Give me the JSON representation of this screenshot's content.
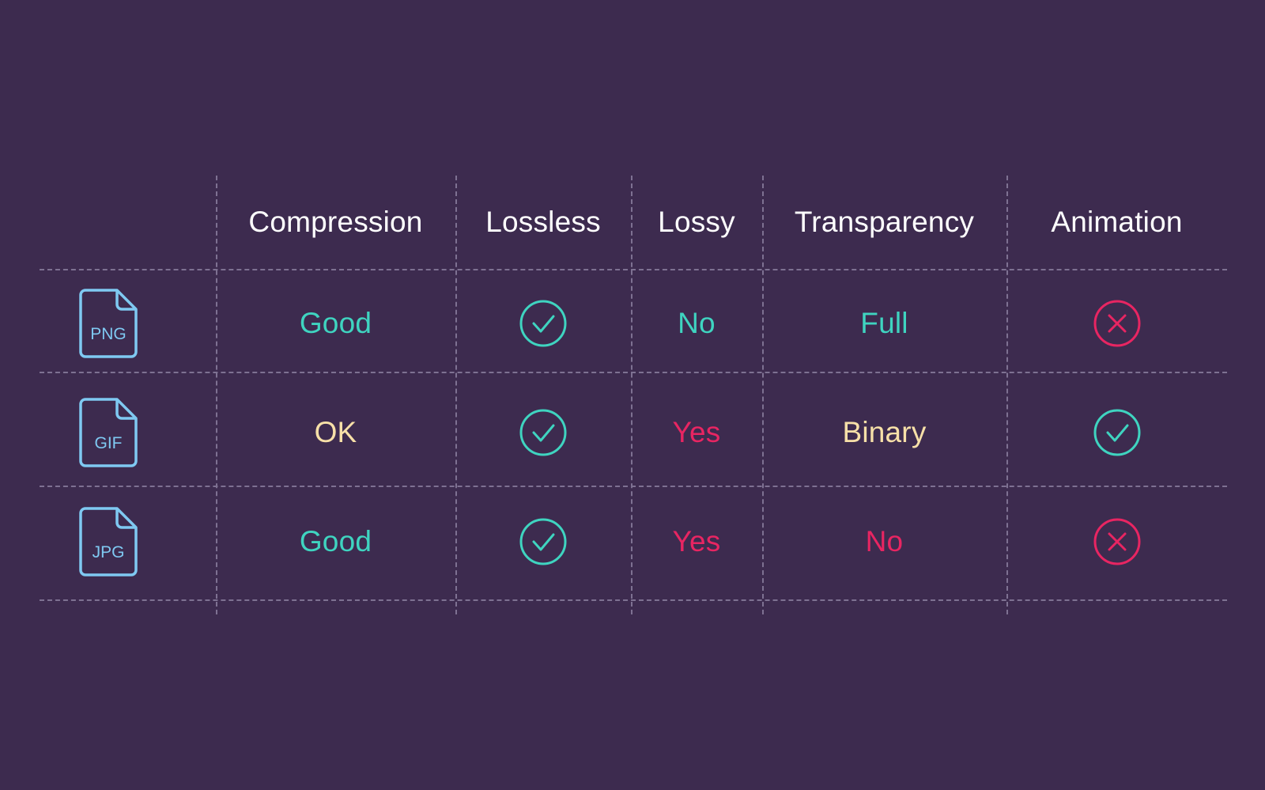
{
  "background_color": "#3D2B4F",
  "accent_colors": {
    "teal": "#3FD4C0",
    "pink": "#E82562",
    "cream": "#F7E0A8",
    "icon_blue": "#7FC9F2",
    "grid": "#7E7192",
    "header_text": "#FFFFFF"
  },
  "table": {
    "columns": [
      {
        "key": "format",
        "label": ""
      },
      {
        "key": "compression",
        "label": "Compression"
      },
      {
        "key": "lossless",
        "label": "Lossless"
      },
      {
        "key": "lossy",
        "label": "Lossy"
      },
      {
        "key": "transparency",
        "label": "Transparency"
      },
      {
        "key": "animation",
        "label": "Animation"
      }
    ],
    "rows": [
      {
        "format": "PNG",
        "format_icon": "file-icon",
        "compression": {
          "text": "Good",
          "color": "teal"
        },
        "lossless": {
          "icon": "check-circle-icon",
          "color": "teal"
        },
        "lossy": {
          "text": "No",
          "color": "teal"
        },
        "transparency": {
          "text": "Full",
          "color": "teal"
        },
        "animation": {
          "icon": "x-circle-icon",
          "color": "pink"
        }
      },
      {
        "format": "GIF",
        "format_icon": "file-icon",
        "compression": {
          "text": "OK",
          "color": "cream"
        },
        "lossless": {
          "icon": "check-circle-icon",
          "color": "teal"
        },
        "lossy": {
          "text": "Yes",
          "color": "pink"
        },
        "transparency": {
          "text": "Binary",
          "color": "cream"
        },
        "animation": {
          "icon": "check-circle-icon",
          "color": "teal"
        }
      },
      {
        "format": "JPG",
        "format_icon": "file-icon",
        "compression": {
          "text": "Good",
          "color": "teal"
        },
        "lossless": {
          "icon": "check-circle-icon",
          "color": "teal"
        },
        "lossy": {
          "text": "Yes",
          "color": "pink"
        },
        "transparency": {
          "text": "No",
          "color": "pink"
        },
        "animation": {
          "icon": "x-circle-icon",
          "color": "pink"
        }
      }
    ]
  }
}
